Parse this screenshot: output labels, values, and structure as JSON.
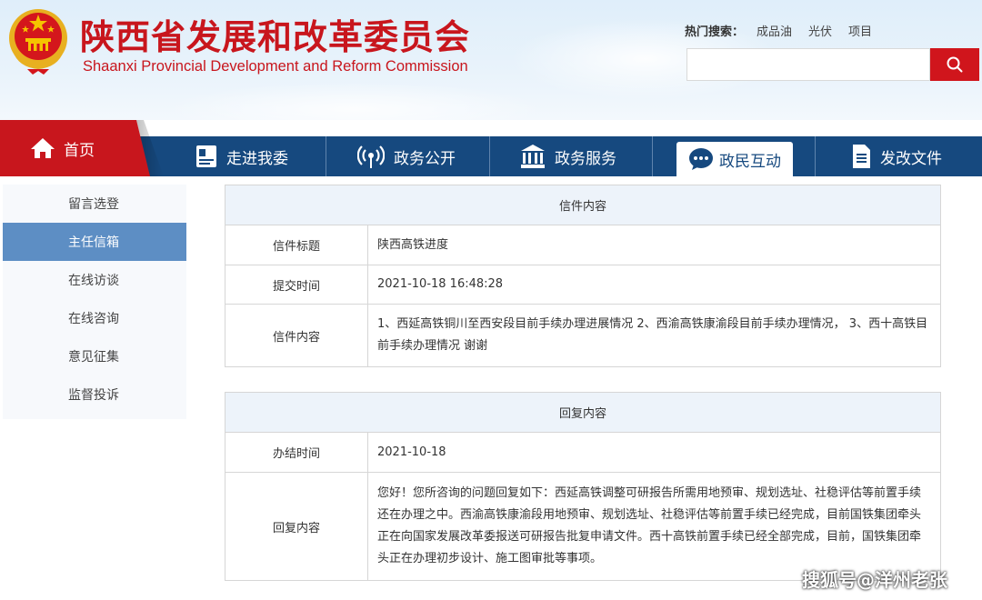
{
  "header": {
    "title": "陕西省发展和改革委员会",
    "subtitle": "Shaanxi Provincial Development and Reform Commission",
    "hot_search": {
      "label": "热门搜索：",
      "items": [
        "成品油",
        "光伏",
        "项目"
      ]
    },
    "search": {
      "placeholder": "",
      "button_icon": "search-icon"
    },
    "colors": {
      "brand_red": "#c8161d",
      "nav_blue": "#16497f",
      "sidebar_active": "#5d8ec4"
    }
  },
  "nav": {
    "home": {
      "label": "首页",
      "icon": "home-icon"
    },
    "items": [
      {
        "label": "走进我委",
        "icon": "id-card-icon"
      },
      {
        "label": "政务公开",
        "icon": "broadcast-icon"
      },
      {
        "label": "政务服务",
        "icon": "building-icon"
      },
      {
        "label": "政民互动",
        "icon": "chat-icon",
        "active": true
      },
      {
        "label": "发改文件",
        "icon": "document-icon"
      }
    ]
  },
  "sidebar": {
    "items": [
      {
        "label": "留言选登"
      },
      {
        "label": "主任信箱",
        "active": true
      },
      {
        "label": "在线访谈"
      },
      {
        "label": "在线咨询"
      },
      {
        "label": "意见征集"
      },
      {
        "label": "监督投诉"
      }
    ]
  },
  "letter": {
    "heading": "信件内容",
    "rows": [
      {
        "label": "信件标题",
        "value": "陕西高铁进度"
      },
      {
        "label": "提交时间",
        "value": "2021-10-18 16:48:28"
      },
      {
        "label": "信件内容",
        "value": "1、西延高铁铜川至西安段目前手续办理进展情况 2、西渝高铁康渝段目前手续办理情况， 3、西十高铁目前手续办理情况 谢谢"
      }
    ]
  },
  "reply": {
    "heading": "回复内容",
    "rows": [
      {
        "label": "办结时间",
        "value": "2021-10-18"
      },
      {
        "label": "回复内容",
        "value": "您好！您所咨询的问题回复如下：西延高铁调整可研报告所需用地预审、规划选址、社稳评估等前置手续还在办理之中。西渝高铁康渝段用地预审、规划选址、社稳评估等前置手续已经完成，目前国铁集团牵头正在向国家发展改革委报送可研报告批复申请文件。西十高铁前置手续已经全部完成，目前，国铁集团牵头正在办理初步设计、施工图审批等事项。"
      }
    ]
  },
  "watermark": "搜狐号@洋州老张"
}
